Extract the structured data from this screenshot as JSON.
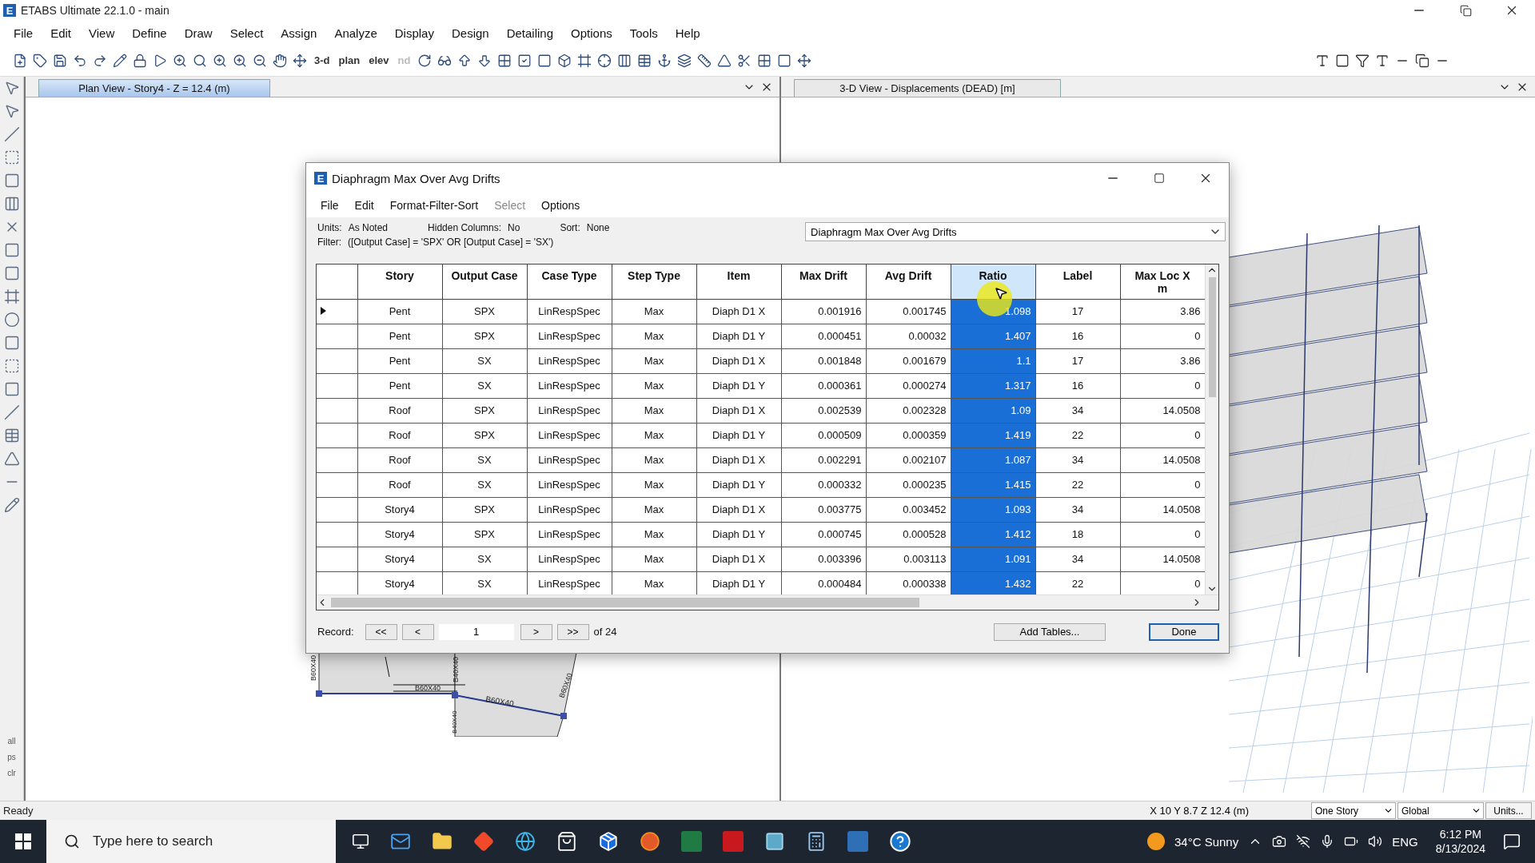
{
  "window": {
    "logo": "E",
    "title": "ETABS Ultimate 22.1.0 - main"
  },
  "menu": [
    "File",
    "Edit",
    "View",
    "Define",
    "Draw",
    "Select",
    "Assign",
    "Analyze",
    "Display",
    "Design",
    "Detailing",
    "Options",
    "Tools",
    "Help"
  ],
  "toolbar_labels": [
    {
      "text": "3-d",
      "disabled": false
    },
    {
      "text": "plan",
      "disabled": false
    },
    {
      "text": "elev",
      "disabled": false
    },
    {
      "text": "nd",
      "disabled": true
    }
  ],
  "left_toolbar_labels": [
    "all",
    "ps",
    "clr"
  ],
  "panes": [
    {
      "title": "Plan View - Story4 - Z = 12.4 (m)",
      "active": true
    },
    {
      "title": "3-D View  - Displacements (DEAD)  [m]",
      "active": false
    }
  ],
  "plan_labels": [
    "B60X40",
    "B40X40",
    "B60X40",
    "B60X40",
    "B40X40",
    "B60X40"
  ],
  "dialog": {
    "logo": "E",
    "title": "Diaphragm Max Over Avg Drifts",
    "menu": [
      {
        "label": "File",
        "disabled": false
      },
      {
        "label": "Edit",
        "disabled": false
      },
      {
        "label": "Format-Filter-Sort",
        "disabled": false
      },
      {
        "label": "Select",
        "disabled": true
      },
      {
        "label": "Options",
        "disabled": false
      }
    ],
    "info": [
      {
        "label": "Units:",
        "value": "As Noted"
      },
      {
        "label": "Hidden Columns:",
        "value": "No"
      },
      {
        "label": "Sort:",
        "value": "None"
      }
    ],
    "filter": {
      "label": "Filter:",
      "value": "([Output Case] = 'SPX' OR [Output Case] = 'SX')"
    },
    "table_select": "Diaphragm Max Over Avg Drifts",
    "columns": [
      {
        "label": "Story",
        "selected": false
      },
      {
        "label": "Output Case",
        "selected": false
      },
      {
        "label": "Case Type",
        "selected": false
      },
      {
        "label": "Step Type",
        "selected": false
      },
      {
        "label": "Item",
        "selected": false
      },
      {
        "label": "Max Drift",
        "selected": false
      },
      {
        "label": "Avg Drift",
        "selected": false
      },
      {
        "label": "Ratio",
        "selected": true
      },
      {
        "label": "Label",
        "selected": false
      },
      {
        "label": "Max Loc X",
        "unit": "m",
        "selected": false
      }
    ],
    "rows": [
      {
        "current": true,
        "cells": [
          "Pent",
          "SPX",
          "LinRespSpec",
          "Max",
          "Diaph D1 X",
          "0.001916",
          "0.001745",
          "1.098",
          "17",
          "3.86"
        ]
      },
      {
        "current": false,
        "cells": [
          "Pent",
          "SPX",
          "LinRespSpec",
          "Max",
          "Diaph D1 Y",
          "0.000451",
          "0.00032",
          "1.407",
          "16",
          "0"
        ]
      },
      {
        "current": false,
        "cells": [
          "Pent",
          "SX",
          "LinRespSpec",
          "Max",
          "Diaph D1 X",
          "0.001848",
          "0.001679",
          "1.1",
          "17",
          "3.86"
        ]
      },
      {
        "current": false,
        "cells": [
          "Pent",
          "SX",
          "LinRespSpec",
          "Max",
          "Diaph D1 Y",
          "0.000361",
          "0.000274",
          "1.317",
          "16",
          "0"
        ]
      },
      {
        "current": false,
        "cells": [
          "Roof",
          "SPX",
          "LinRespSpec",
          "Max",
          "Diaph D1 X",
          "0.002539",
          "0.002328",
          "1.09",
          "34",
          "14.0508"
        ]
      },
      {
        "current": false,
        "cells": [
          "Roof",
          "SPX",
          "LinRespSpec",
          "Max",
          "Diaph D1 Y",
          "0.000509",
          "0.000359",
          "1.419",
          "22",
          "0"
        ]
      },
      {
        "current": false,
        "cells": [
          "Roof",
          "SX",
          "LinRespSpec",
          "Max",
          "Diaph D1 X",
          "0.002291",
          "0.002107",
          "1.087",
          "34",
          "14.0508"
        ]
      },
      {
        "current": false,
        "cells": [
          "Roof",
          "SX",
          "LinRespSpec",
          "Max",
          "Diaph D1 Y",
          "0.000332",
          "0.000235",
          "1.415",
          "22",
          "0"
        ]
      },
      {
        "current": false,
        "cells": [
          "Story4",
          "SPX",
          "LinRespSpec",
          "Max",
          "Diaph D1 X",
          "0.003775",
          "0.003452",
          "1.093",
          "34",
          "14.0508"
        ]
      },
      {
        "current": false,
        "cells": [
          "Story4",
          "SPX",
          "LinRespSpec",
          "Max",
          "Diaph D1 Y",
          "0.000745",
          "0.000528",
          "1.412",
          "18",
          "0"
        ]
      },
      {
        "current": false,
        "cells": [
          "Story4",
          "SX",
          "LinRespSpec",
          "Max",
          "Diaph D1 X",
          "0.003396",
          "0.003113",
          "1.091",
          "34",
          "14.0508"
        ]
      },
      {
        "current": false,
        "cells": [
          "Story4",
          "SX",
          "LinRespSpec",
          "Max",
          "Diaph D1 Y",
          "0.000484",
          "0.000338",
          "1.432",
          "22",
          "0"
        ]
      }
    ],
    "record": {
      "label": "Record:",
      "prev_buttons": [
        "<<",
        "<"
      ],
      "value": "1",
      "next_buttons": [
        ">",
        ">>"
      ],
      "total": "of 24"
    },
    "actions": [
      {
        "label": "Add Tables...",
        "default": false
      },
      {
        "label": "Done",
        "default": true
      }
    ]
  },
  "status_bar": {
    "text": "Ready",
    "coords": "X 10  Y 8.7  Z 12.4 (m)",
    "dropdowns": [
      "One Story",
      "Global"
    ],
    "button": "Units..."
  },
  "taskbar": {
    "search_placeholder": "Type here to search",
    "weather": "34°C  Sunny",
    "language": "ENG",
    "time": "6:12 PM",
    "date": "8/13/2024"
  }
}
